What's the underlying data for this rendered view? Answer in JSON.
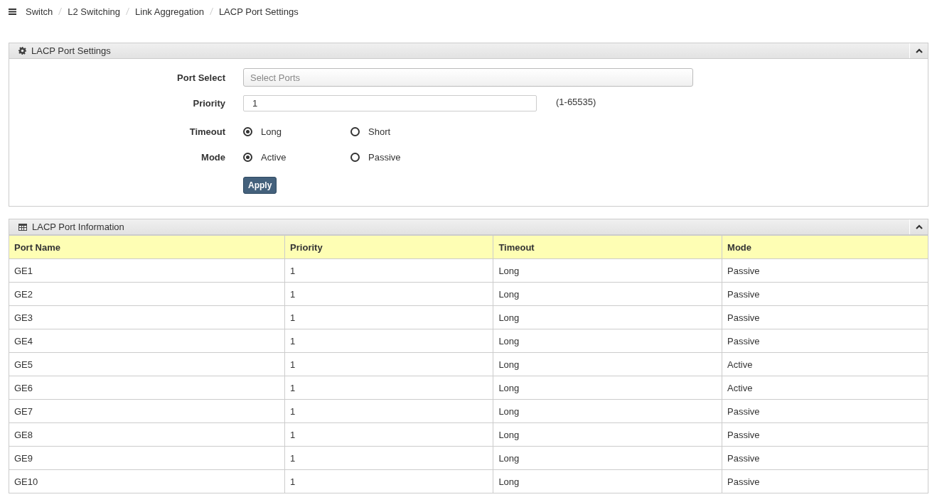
{
  "breadcrumb": [
    "Switch",
    "L2 Switching",
    "Link Aggregation",
    "LACP Port Settings"
  ],
  "settings_panel": {
    "title": "LACP Port Settings",
    "port_select": {
      "label": "Port Select",
      "placeholder": "Select Ports"
    },
    "priority": {
      "label": "Priority",
      "value": "1",
      "hint": "(1-65535)"
    },
    "timeout": {
      "label": "Timeout",
      "options": [
        {
          "label": "Long",
          "selected": true
        },
        {
          "label": "Short",
          "selected": false
        }
      ]
    },
    "mode": {
      "label": "Mode",
      "options": [
        {
          "label": "Active",
          "selected": true
        },
        {
          "label": "Passive",
          "selected": false
        }
      ]
    },
    "apply_button": "Apply"
  },
  "info_panel": {
    "title": "LACP Port Information",
    "table": {
      "columns": [
        "Port Name",
        "Priority",
        "Timeout",
        "Mode"
      ],
      "rows": [
        [
          "GE1",
          "1",
          "Long",
          "Passive"
        ],
        [
          "GE2",
          "1",
          "Long",
          "Passive"
        ],
        [
          "GE3",
          "1",
          "Long",
          "Passive"
        ],
        [
          "GE4",
          "1",
          "Long",
          "Passive"
        ],
        [
          "GE5",
          "1",
          "Long",
          "Active"
        ],
        [
          "GE6",
          "1",
          "Long",
          "Active"
        ],
        [
          "GE7",
          "1",
          "Long",
          "Passive"
        ],
        [
          "GE8",
          "1",
          "Long",
          "Passive"
        ],
        [
          "GE9",
          "1",
          "Long",
          "Passive"
        ],
        [
          "GE10",
          "1",
          "Long",
          "Passive"
        ]
      ]
    }
  }
}
